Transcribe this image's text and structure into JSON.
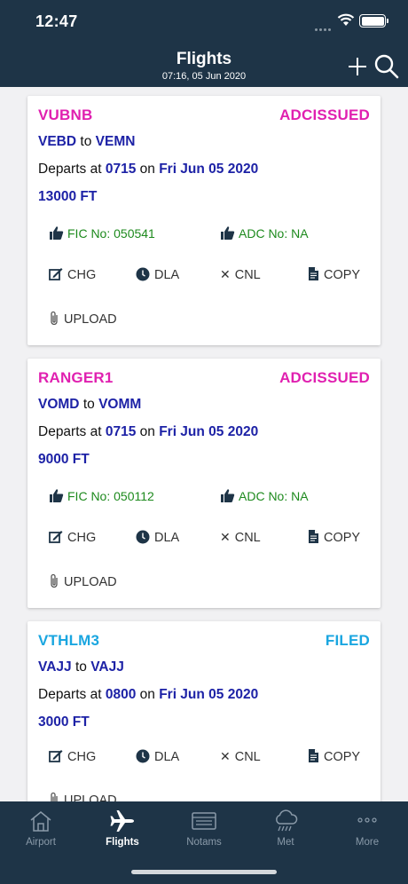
{
  "status_bar": {
    "time": "12:47"
  },
  "header": {
    "title": "Flights",
    "subtitle": "07:16, 05 Jun 2020"
  },
  "flights": [
    {
      "callsign": "VUBNB",
      "status": "ADCISSUED",
      "status_color": "#e020b0",
      "from": "VEBD",
      "to_word": "to",
      "to": "VEMN",
      "departs_prefix": "Departs at",
      "time": "0715",
      "on_word": "on",
      "date": "Fri Jun 05 2020",
      "level": "13000 FT",
      "fic": "FIC No: 050541",
      "adc": "ADC No: NA"
    },
    {
      "callsign": "RANGER1",
      "status": "ADCISSUED",
      "status_color": "#e020b0",
      "from": "VOMD",
      "to_word": "to",
      "to": "VOMM",
      "departs_prefix": "Departs at",
      "time": "0715",
      "on_word": "on",
      "date": "Fri Jun 05 2020",
      "level": "9000 FT",
      "fic": "FIC No: 050112",
      "adc": "ADC No: NA"
    },
    {
      "callsign": "VTHLM3",
      "status": "FILED",
      "status_color": "#1aa6e0",
      "from": "VAJJ",
      "to_word": "to",
      "to": "VAJJ",
      "departs_prefix": "Departs at",
      "time": "0800",
      "on_word": "on",
      "date": "Fri Jun 05 2020",
      "level": "3000 FT"
    }
  ],
  "actions": {
    "chg": "CHG",
    "dla": "DLA",
    "cnl": "CNL",
    "copy": "COPY",
    "upload": "UPLOAD"
  },
  "tabs": [
    {
      "label": "Airport",
      "icon": "airport-icon"
    },
    {
      "label": "Flights",
      "icon": "airplane-icon",
      "active": true
    },
    {
      "label": "Notams",
      "icon": "notams-icon"
    },
    {
      "label": "Met",
      "icon": "cloud-rain-icon"
    },
    {
      "label": "More",
      "icon": "more-dots-icon"
    }
  ],
  "colors": {
    "bar": "#1e3447",
    "link_blue": "#1d22a6",
    "green": "#1d8a1d"
  }
}
